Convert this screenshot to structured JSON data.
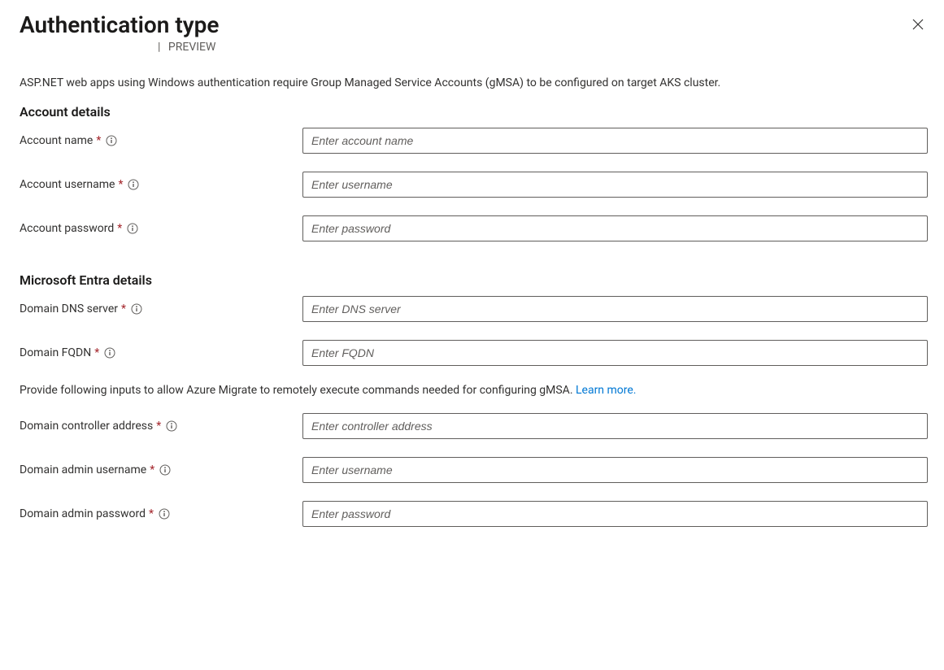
{
  "header": {
    "title": "Authentication type",
    "breadcrumb_preview": "PREVIEW"
  },
  "description": "ASP.NET web apps using Windows authentication require Group Managed Service Accounts (gMSA) to be configured on target AKS cluster.",
  "sections": {
    "account": {
      "heading": "Account details",
      "fields": {
        "account_name": {
          "label": "Account name",
          "placeholder": "Enter account name",
          "value": ""
        },
        "account_username": {
          "label": "Account username",
          "placeholder": "Enter username",
          "value": ""
        },
        "account_password": {
          "label": "Account password",
          "placeholder": "Enter password",
          "value": ""
        }
      }
    },
    "entra": {
      "heading": "Microsoft Entra details",
      "fields": {
        "domain_dns": {
          "label": "Domain DNS server",
          "placeholder": "Enter DNS server",
          "value": ""
        },
        "domain_fqdn": {
          "label": "Domain FQDN",
          "placeholder": "Enter FQDN",
          "value": ""
        },
        "domain_controller": {
          "label": "Domain controller address",
          "placeholder": "Enter controller address",
          "value": ""
        },
        "domain_admin_username": {
          "label": "Domain admin username",
          "placeholder": "Enter username",
          "value": ""
        },
        "domain_admin_password": {
          "label": "Domain admin password",
          "placeholder": "Enter password",
          "value": ""
        }
      },
      "helper_text": "Provide following inputs to allow Azure Migrate to remotely execute commands needed for configuring gMSA. ",
      "learn_more": "Learn more."
    }
  },
  "required_marker": "*"
}
